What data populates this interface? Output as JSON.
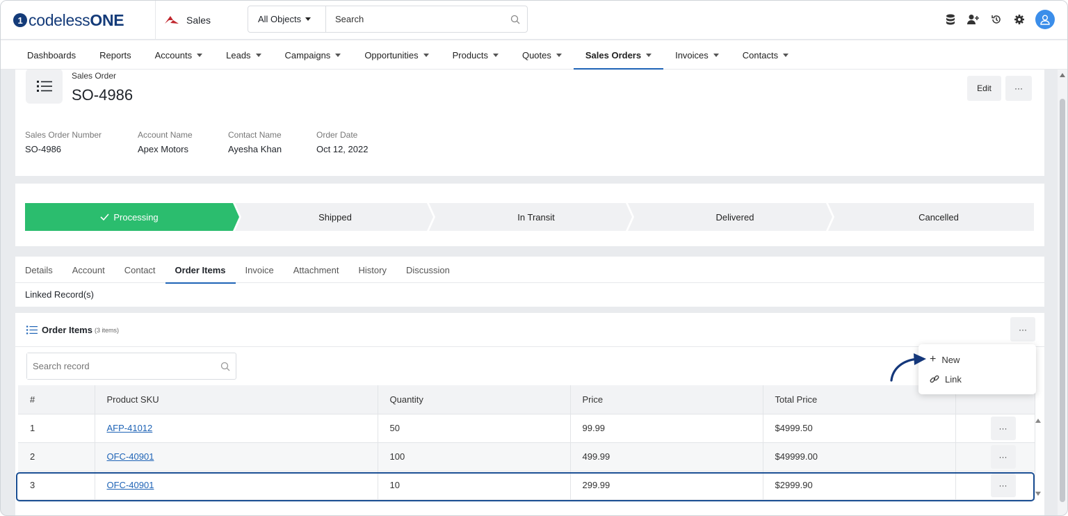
{
  "brand": {
    "logo_mark": "1",
    "logo_text_a": "codeless",
    "logo_text_b": "ONE",
    "app_name": "Sales"
  },
  "search": {
    "object_filter": "All Objects",
    "placeholder": "Search"
  },
  "nav": [
    "Dashboards",
    "Reports",
    "Accounts",
    "Leads",
    "Campaigns",
    "Opportunities",
    "Products",
    "Quotes",
    "Sales Orders",
    "Invoices",
    "Contacts"
  ],
  "record": {
    "type_label": "Sales Order",
    "title": "SO-4986",
    "edit_label": "Edit",
    "more_label": "···"
  },
  "fields": [
    {
      "label": "Sales Order Number",
      "value": "SO-4986"
    },
    {
      "label": "Account Name",
      "value": "Apex Motors"
    },
    {
      "label": "Contact Name",
      "value": "Ayesha Khan"
    },
    {
      "label": "Order Date",
      "value": "Oct 12, 2022"
    }
  ],
  "stages": {
    "current": "Processing",
    "items": [
      "Processing",
      "Shipped",
      "In Transit",
      "Delivered",
      "Cancelled"
    ],
    "active_color": "#2bbd6e"
  },
  "tabs": [
    "Details",
    "Account",
    "Contact",
    "Order Items",
    "Invoice",
    "Attachment",
    "History",
    "Discussion"
  ],
  "linked_label": "Linked Record(s)",
  "order_items": {
    "title": "Order Items",
    "count_label": "(3 items)",
    "more_label": "···",
    "search_placeholder": "Search record",
    "columns": [
      "#",
      "Product SKU",
      "Quantity",
      "Price",
      "Total Price"
    ],
    "rows": [
      {
        "num": "1",
        "sku": "AFP-41012",
        "qty": "50",
        "price": "99.99",
        "total": "$4999.50"
      },
      {
        "num": "2",
        "sku": "OFC-40901",
        "qty": "100",
        "price": "499.99",
        "total": "$49999.00"
      },
      {
        "num": "3",
        "sku": "OFC-40901",
        "qty": "10",
        "price": "299.99",
        "total": "$2999.90"
      }
    ],
    "row_more_label": "···"
  },
  "dropdown": {
    "new_label": "New",
    "link_label": "Link"
  },
  "colors": {
    "accent": "#1e63b6",
    "brand": "#143b79",
    "success": "#2bbd6e"
  }
}
